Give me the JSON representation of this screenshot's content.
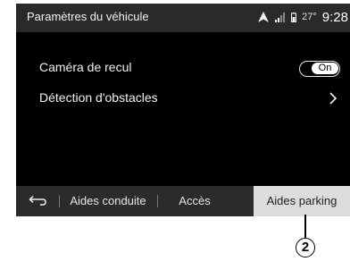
{
  "status_bar": {
    "title": "Paramètres du véhicule",
    "temperature": "27°",
    "time": "9:28",
    "icons": [
      "navigation-icon",
      "signal-icon",
      "battery-icon"
    ]
  },
  "settings": [
    {
      "label": "Caméra de recul",
      "control": "toggle",
      "toggle_text": "On"
    },
    {
      "label": "Détection d'obstacles",
      "control": "chevron"
    }
  ],
  "tab_bar": {
    "back_icon": "back-arrow-icon",
    "tabs": [
      {
        "label": "Aides conduite",
        "selected": false
      },
      {
        "label": "Accès",
        "selected": false
      },
      {
        "label": "Aides parking",
        "selected": true
      }
    ]
  },
  "callout": {
    "number": "2"
  }
}
